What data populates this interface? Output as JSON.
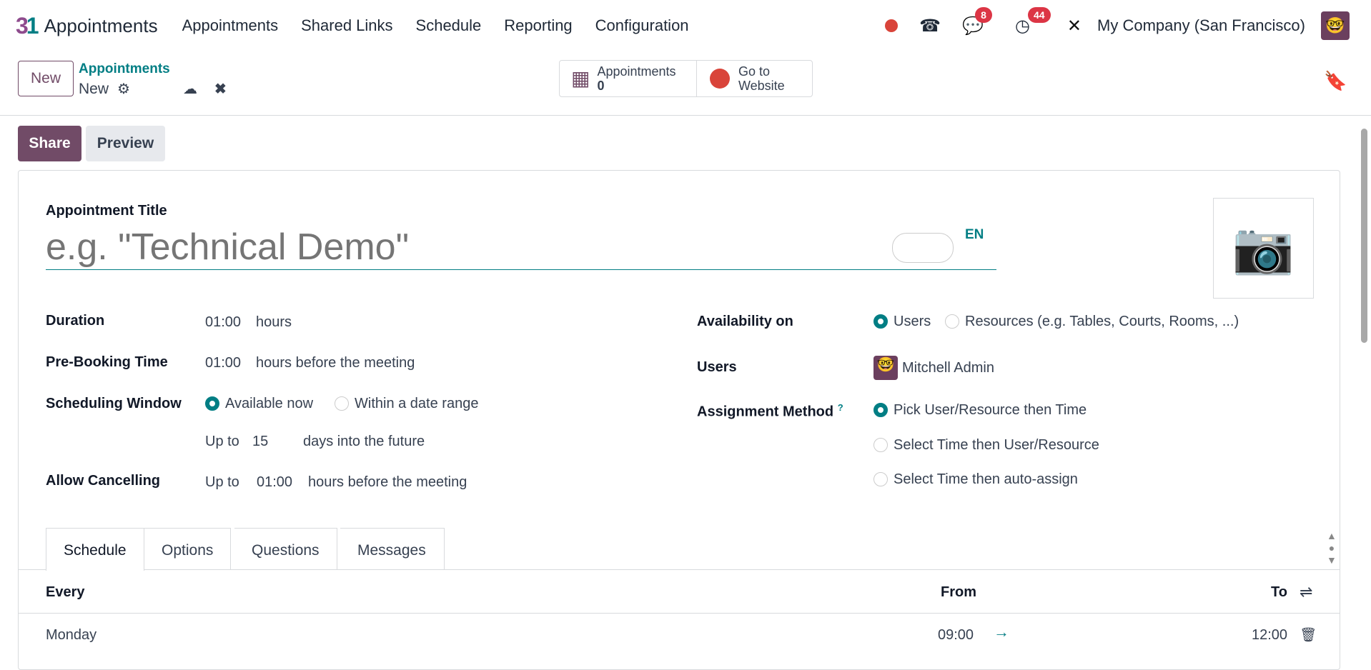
{
  "nav": {
    "app": "Appointments",
    "menu": [
      "Appointments",
      "Shared Links",
      "Schedule",
      "Reporting",
      "Configuration"
    ],
    "messages_count": "8",
    "activities_count": "44",
    "company": "My Company (San Francisco)"
  },
  "control": {
    "new": "New",
    "breadcrumb_parent": "Appointments",
    "breadcrumb_current": "New",
    "stat_appointments_label": "Appointments",
    "stat_appointments_value": "0",
    "go_to_website": "Go to Website"
  },
  "actions": {
    "share": "Share",
    "preview": "Preview"
  },
  "form": {
    "title_label": "Appointment Title",
    "title_placeholder": "e.g. \"Technical Demo\"",
    "lang": "EN",
    "duration_label": "Duration",
    "duration_value": "01:00",
    "duration_unit": "hours",
    "prebooking_label": "Pre-Booking Time",
    "prebooking_value": "01:00",
    "prebooking_unit": "hours before the meeting",
    "window_label": "Scheduling Window",
    "window_opt1": "Available now",
    "window_opt2": "Within a date range",
    "upto": "Up to",
    "days_value": "15",
    "days_unit": "days into the future",
    "cancel_label": "Allow Cancelling",
    "cancel_upto": "Up to",
    "cancel_value": "01:00",
    "cancel_unit": "hours before the meeting",
    "availability_label": "Availability on",
    "avail_opt1": "Users",
    "avail_opt2": "Resources (e.g. Tables, Courts, Rooms, ...)",
    "users_label": "Users",
    "user_name": "Mitchell Admin",
    "assign_label": "Assignment Method",
    "assign_help": "?",
    "assign_opts": [
      "Pick User/Resource then Time",
      "Select Time then User/Resource",
      "Select Time then auto-assign"
    ]
  },
  "tabs": [
    "Schedule",
    "Options",
    "Questions",
    "Messages"
  ],
  "table": {
    "headers": [
      "Every",
      "From",
      "To"
    ],
    "rows": [
      {
        "day": "Monday",
        "from": "09:00",
        "to": "12:00"
      }
    ]
  }
}
